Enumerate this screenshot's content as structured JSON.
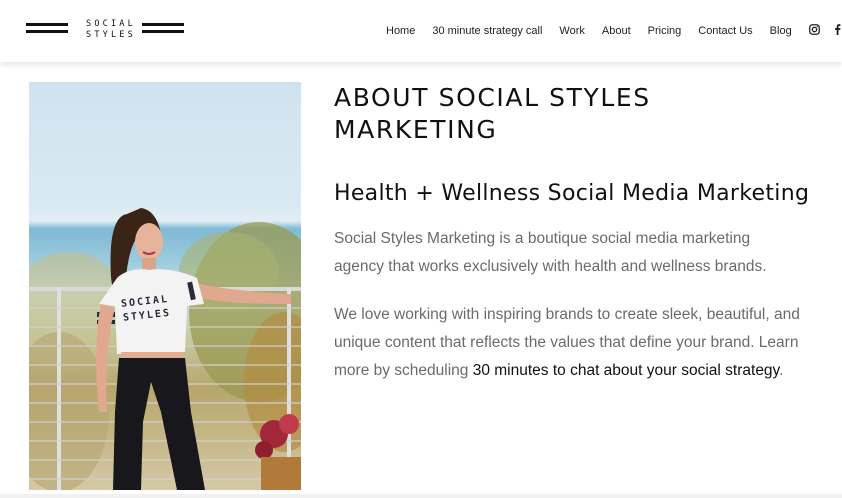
{
  "header": {
    "logo_top": "SOCIAL",
    "logo_bottom": "STYLES",
    "nav": [
      "Home",
      "30 minute strategy call",
      "Work",
      "About",
      "Pricing",
      "Contact Us",
      "Blog"
    ],
    "social_icons": [
      "instagram-icon",
      "facebook-icon"
    ]
  },
  "about": {
    "title": "ABOUT SOCIAL STYLES MARKETING",
    "subtitle": "Health + Wellness Social Media Marketing",
    "paragraph1": "Social Styles Marketing is a boutique social media marketing agency that works exclusively with health and wellness brands.",
    "paragraph2_text": "We love working with inspiring brands to create sleek, beautiful, and unique content that reflects the values that define your brand. Learn more by scheduling ",
    "paragraph2_link": "30 minutes to chat about your social strategy",
    "paragraph2_end": ".",
    "shirt_top": "SOCIAL",
    "shirt_bottom": "STYLES"
  },
  "colors": {
    "text_dark": "#111111",
    "text_muted": "#6b6b6b",
    "background": "#ffffff"
  }
}
